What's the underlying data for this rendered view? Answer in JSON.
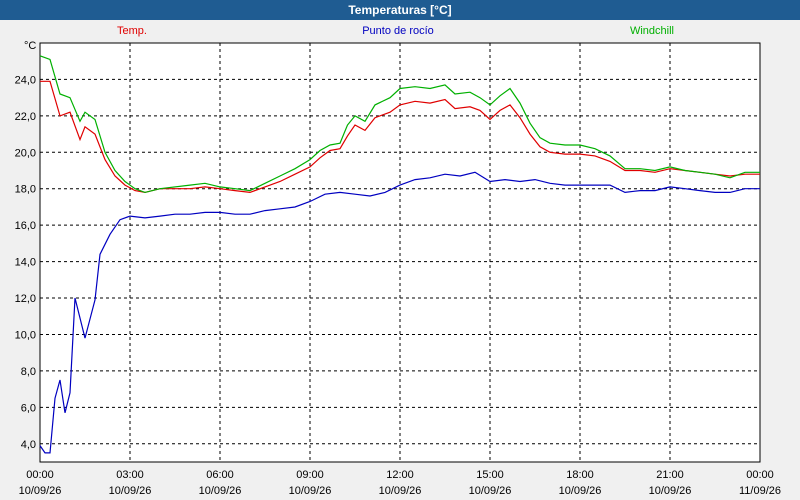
{
  "window": {
    "title": "Temperaturas [°C]"
  },
  "chart_data": {
    "type": "line",
    "ylabel_unit": "°C",
    "ylim": [
      3.0,
      26.0
    ],
    "xlim_hours": [
      0,
      24
    ],
    "grid": true,
    "y_ticks": [
      4.0,
      6.0,
      8.0,
      10.0,
      12.0,
      14.0,
      16.0,
      18.0,
      20.0,
      22.0,
      24.0
    ],
    "y_tick_labels": [
      "4,0",
      "6,0",
      "8,0",
      "10,0",
      "12,0",
      "14,0",
      "16,0",
      "18,0",
      "20,0",
      "22,0",
      "24,0"
    ],
    "x_ticks": [
      {
        "time": "00:00",
        "date": "10/09/26"
      },
      {
        "time": "03:00",
        "date": "10/09/26"
      },
      {
        "time": "06:00",
        "date": "10/09/26"
      },
      {
        "time": "09:00",
        "date": "10/09/26"
      },
      {
        "time": "12:00",
        "date": "10/09/26"
      },
      {
        "time": "15:00",
        "date": "10/09/26"
      },
      {
        "time": "18:00",
        "date": "10/09/26"
      },
      {
        "time": "21:00",
        "date": "10/09/26"
      },
      {
        "time": "00:00",
        "date": "11/09/26"
      }
    ],
    "series": [
      {
        "name": "Temp.",
        "color": "#e00000",
        "points": [
          [
            "10/09/26 00:00",
            23.9
          ],
          [
            "10/09/26 00:20",
            23.9
          ],
          [
            "10/09/26 00:40",
            22.0
          ],
          [
            "10/09/26 01:00",
            22.2
          ],
          [
            "10/09/26 01:20",
            20.7
          ],
          [
            "10/09/26 01:30",
            21.4
          ],
          [
            "10/09/26 01:50",
            21.0
          ],
          [
            "10/09/26 02:10",
            19.6
          ],
          [
            "10/09/26 02:30",
            18.7
          ],
          [
            "10/09/26 02:50",
            18.2
          ],
          [
            "10/09/26 03:10",
            17.9
          ],
          [
            "10/09/26 03:30",
            17.8
          ],
          [
            "10/09/26 04:00",
            18.0
          ],
          [
            "10/09/26 05:00",
            18.0
          ],
          [
            "10/09/26 05:30",
            18.1
          ],
          [
            "10/09/26 06:00",
            18.0
          ],
          [
            "10/09/26 06:30",
            17.9
          ],
          [
            "10/09/26 07:00",
            17.8
          ],
          [
            "10/09/26 07:30",
            18.1
          ],
          [
            "10/09/26 08:00",
            18.4
          ],
          [
            "10/09/26 08:30",
            18.8
          ],
          [
            "10/09/26 09:00",
            19.2
          ],
          [
            "10/09/26 09:20",
            19.7
          ],
          [
            "10/09/26 09:40",
            20.1
          ],
          [
            "10/09/26 10:00",
            20.2
          ],
          [
            "10/09/26 10:15",
            20.9
          ],
          [
            "10/09/26 10:30",
            21.5
          ],
          [
            "10/09/26 10:50",
            21.2
          ],
          [
            "10/09/26 11:10",
            21.9
          ],
          [
            "10/09/26 11:40",
            22.2
          ],
          [
            "10/09/26 12:00",
            22.6
          ],
          [
            "10/09/26 12:30",
            22.8
          ],
          [
            "10/09/26 13:00",
            22.7
          ],
          [
            "10/09/26 13:30",
            22.9
          ],
          [
            "10/09/26 13:50",
            22.4
          ],
          [
            "10/09/26 14:20",
            22.5
          ],
          [
            "10/09/26 14:40",
            22.3
          ],
          [
            "10/09/26 15:00",
            21.8
          ],
          [
            "10/09/26 15:20",
            22.3
          ],
          [
            "10/09/26 15:40",
            22.6
          ],
          [
            "10/09/26 16:00",
            21.9
          ],
          [
            "10/09/26 16:20",
            21.0
          ],
          [
            "10/09/26 16:40",
            20.3
          ],
          [
            "10/09/26 17:00",
            20.0
          ],
          [
            "10/09/26 17:30",
            19.9
          ],
          [
            "10/09/26 18:00",
            19.9
          ],
          [
            "10/09/26 18:30",
            19.8
          ],
          [
            "10/09/26 19:00",
            19.5
          ],
          [
            "10/09/26 19:30",
            19.0
          ],
          [
            "10/09/26 20:00",
            19.0
          ],
          [
            "10/09/26 20:30",
            18.9
          ],
          [
            "10/09/26 21:00",
            19.1
          ],
          [
            "10/09/26 21:30",
            19.0
          ],
          [
            "10/09/26 22:00",
            18.9
          ],
          [
            "10/09/26 22:30",
            18.8
          ],
          [
            "10/09/26 23:00",
            18.7
          ],
          [
            "10/09/26 23:30",
            18.8
          ],
          [
            "11/09/26 00:00",
            18.8
          ]
        ]
      },
      {
        "name": "Punto de rocío",
        "color": "#0000c0",
        "points": [
          [
            "10/09/26 00:00",
            3.9
          ],
          [
            "10/09/26 00:10",
            3.5
          ],
          [
            "10/09/26 00:20",
            3.5
          ],
          [
            "10/09/26 00:30",
            6.5
          ],
          [
            "10/09/26 00:40",
            7.5
          ],
          [
            "10/09/26 00:50",
            5.7
          ],
          [
            "10/09/26 01:00",
            6.8
          ],
          [
            "10/09/26 01:10",
            12.0
          ],
          [
            "10/09/26 01:30",
            9.8
          ],
          [
            "10/09/26 01:50",
            11.9
          ],
          [
            "10/09/26 02:00",
            14.4
          ],
          [
            "10/09/26 02:20",
            15.5
          ],
          [
            "10/09/26 02:40",
            16.3
          ],
          [
            "10/09/26 03:00",
            16.5
          ],
          [
            "10/09/26 03:30",
            16.4
          ],
          [
            "10/09/26 04:00",
            16.5
          ],
          [
            "10/09/26 04:30",
            16.6
          ],
          [
            "10/09/26 05:00",
            16.6
          ],
          [
            "10/09/26 05:30",
            16.7
          ],
          [
            "10/09/26 06:00",
            16.7
          ],
          [
            "10/09/26 06:30",
            16.6
          ],
          [
            "10/09/26 07:00",
            16.6
          ],
          [
            "10/09/26 07:30",
            16.8
          ],
          [
            "10/09/26 08:00",
            16.9
          ],
          [
            "10/09/26 08:30",
            17.0
          ],
          [
            "10/09/26 09:00",
            17.3
          ],
          [
            "10/09/26 09:30",
            17.7
          ],
          [
            "10/09/26 10:00",
            17.8
          ],
          [
            "10/09/26 10:30",
            17.7
          ],
          [
            "10/09/26 11:00",
            17.6
          ],
          [
            "10/09/26 11:30",
            17.8
          ],
          [
            "10/09/26 12:00",
            18.2
          ],
          [
            "10/09/26 12:30",
            18.5
          ],
          [
            "10/09/26 13:00",
            18.6
          ],
          [
            "10/09/26 13:30",
            18.8
          ],
          [
            "10/09/26 14:00",
            18.7
          ],
          [
            "10/09/26 14:30",
            18.9
          ],
          [
            "10/09/26 15:00",
            18.4
          ],
          [
            "10/09/26 15:30",
            18.5
          ],
          [
            "10/09/26 16:00",
            18.4
          ],
          [
            "10/09/26 16:30",
            18.5
          ],
          [
            "10/09/26 17:00",
            18.3
          ],
          [
            "10/09/26 17:30",
            18.2
          ],
          [
            "10/09/26 18:00",
            18.2
          ],
          [
            "10/09/26 18:30",
            18.2
          ],
          [
            "10/09/26 19:00",
            18.2
          ],
          [
            "10/09/26 19:30",
            17.8
          ],
          [
            "10/09/26 20:00",
            17.9
          ],
          [
            "10/09/26 20:30",
            17.9
          ],
          [
            "10/09/26 21:00",
            18.1
          ],
          [
            "10/09/26 21:30",
            18.0
          ],
          [
            "10/09/26 22:00",
            17.9
          ],
          [
            "10/09/26 22:30",
            17.8
          ],
          [
            "10/09/26 23:00",
            17.8
          ],
          [
            "10/09/26 23:30",
            18.0
          ],
          [
            "11/09/26 00:00",
            18.0
          ]
        ]
      },
      {
        "name": "Windchill",
        "color": "#00b000",
        "points": [
          [
            "10/09/26 00:00",
            25.3
          ],
          [
            "10/09/26 00:20",
            25.1
          ],
          [
            "10/09/26 00:40",
            23.2
          ],
          [
            "10/09/26 01:00",
            23.0
          ],
          [
            "10/09/26 01:20",
            21.7
          ],
          [
            "10/09/26 01:30",
            22.2
          ],
          [
            "10/09/26 01:50",
            21.8
          ],
          [
            "10/09/26 02:10",
            20.0
          ],
          [
            "10/09/26 02:30",
            19.0
          ],
          [
            "10/09/26 02:50",
            18.4
          ],
          [
            "10/09/26 03:10",
            18.0
          ],
          [
            "10/09/26 03:30",
            17.8
          ],
          [
            "10/09/26 04:00",
            18.0
          ],
          [
            "10/09/26 05:00",
            18.2
          ],
          [
            "10/09/26 05:30",
            18.3
          ],
          [
            "10/09/26 06:00",
            18.1
          ],
          [
            "10/09/26 06:30",
            18.0
          ],
          [
            "10/09/26 07:00",
            17.9
          ],
          [
            "10/09/26 07:30",
            18.3
          ],
          [
            "10/09/26 08:00",
            18.7
          ],
          [
            "10/09/26 08:30",
            19.1
          ],
          [
            "10/09/26 09:00",
            19.6
          ],
          [
            "10/09/26 09:20",
            20.1
          ],
          [
            "10/09/26 09:40",
            20.4
          ],
          [
            "10/09/26 10:00",
            20.5
          ],
          [
            "10/09/26 10:15",
            21.5
          ],
          [
            "10/09/26 10:30",
            22.0
          ],
          [
            "10/09/26 10:50",
            21.7
          ],
          [
            "10/09/26 11:10",
            22.6
          ],
          [
            "10/09/26 11:40",
            23.0
          ],
          [
            "10/09/26 12:00",
            23.5
          ],
          [
            "10/09/26 12:30",
            23.6
          ],
          [
            "10/09/26 13:00",
            23.5
          ],
          [
            "10/09/26 13:30",
            23.7
          ],
          [
            "10/09/26 13:50",
            23.2
          ],
          [
            "10/09/26 14:20",
            23.3
          ],
          [
            "10/09/26 14:40",
            23.0
          ],
          [
            "10/09/26 15:00",
            22.6
          ],
          [
            "10/09/26 15:20",
            23.1
          ],
          [
            "10/09/26 15:40",
            23.5
          ],
          [
            "10/09/26 16:00",
            22.7
          ],
          [
            "10/09/26 16:20",
            21.6
          ],
          [
            "10/09/26 16:40",
            20.8
          ],
          [
            "10/09/26 17:00",
            20.5
          ],
          [
            "10/09/26 17:30",
            20.4
          ],
          [
            "10/09/26 18:00",
            20.4
          ],
          [
            "10/09/26 18:30",
            20.2
          ],
          [
            "10/09/26 19:00",
            19.8
          ],
          [
            "10/09/26 19:30",
            19.1
          ],
          [
            "10/09/26 20:00",
            19.1
          ],
          [
            "10/09/26 20:30",
            19.0
          ],
          [
            "10/09/26 21:00",
            19.2
          ],
          [
            "10/09/26 21:30",
            19.0
          ],
          [
            "10/09/26 22:00",
            18.9
          ],
          [
            "10/09/26 22:30",
            18.8
          ],
          [
            "10/09/26 23:00",
            18.6
          ],
          [
            "10/09/26 23:30",
            18.9
          ],
          [
            "11/09/26 00:00",
            18.9
          ]
        ]
      }
    ]
  }
}
